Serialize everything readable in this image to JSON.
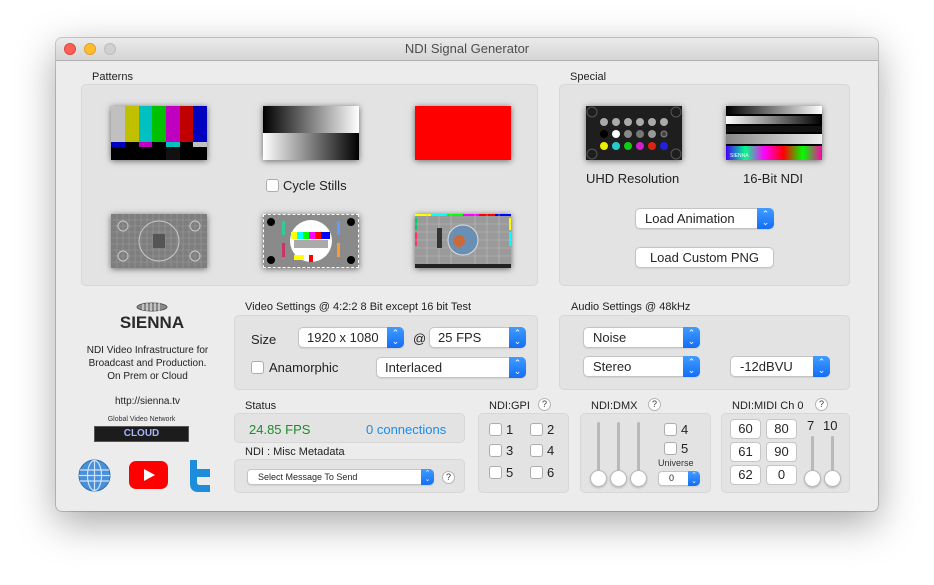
{
  "window": {
    "title": "NDI Signal Generator",
    "traffic_lights": [
      "close",
      "minimize",
      "zoom"
    ]
  },
  "patterns": {
    "label": "Patterns",
    "items": [
      {
        "name": "SMPTE Color Bars"
      },
      {
        "name": "Grayscale Ramp"
      },
      {
        "name": "Red Field"
      },
      {
        "name": "Grid Test Card"
      },
      {
        "name": "PM5544-style Test Card"
      },
      {
        "name": "Test Card F"
      }
    ],
    "cycle_stills_label": "Cycle Stills",
    "cycle_stills_checked": false
  },
  "special": {
    "label": "Special",
    "items": [
      {
        "label": "UHD Resolution"
      },
      {
        "label": "16-Bit NDI"
      }
    ],
    "load_animation": "Load Animation",
    "load_custom_png": "Load Custom PNG"
  },
  "brand": {
    "logo_text": "SIENNA",
    "tagline_1": "NDI Video Infrastructure for",
    "tagline_2": "Broadcast and Production.",
    "tagline_3": "On Prem or Cloud",
    "url": "http://sienna.tv",
    "network_label": "Global Video Network",
    "cloud_badge": "CLOUD",
    "social_icons": [
      "globe-icon",
      "youtube-icon",
      "twitter-icon"
    ]
  },
  "video": {
    "label": "Video Settings @ 4:2:2 8 Bit except 16 bit Test",
    "size_label": "Size",
    "size_value": "1920 x 1080",
    "at_label": "@",
    "fps_value": "25 FPS",
    "anamorphic_label": "Anamorphic",
    "anamorphic_checked": false,
    "scan_value": "Interlaced"
  },
  "audio": {
    "label": "Audio Settings @ 48kHz",
    "signal_value": "Noise",
    "channels_value": "Stereo",
    "level_value": "-12dBVU"
  },
  "status": {
    "label": "Status",
    "fps": "24.85 FPS",
    "connections": "0 connections",
    "fps_color": "#1f8a2e",
    "connections_color": "#1a8cf0"
  },
  "metadata": {
    "label": "NDI : Misc Metadata",
    "select_value": "Select Message To Send",
    "help": "?"
  },
  "gpi": {
    "label": "NDI:GPI",
    "help": "?",
    "items": [
      {
        "label": "1",
        "checked": false
      },
      {
        "label": "2",
        "checked": false
      },
      {
        "label": "3",
        "checked": false
      },
      {
        "label": "4",
        "checked": false
      },
      {
        "label": "5",
        "checked": false
      },
      {
        "label": "6",
        "checked": false
      }
    ]
  },
  "dmx": {
    "label": "NDI:DMX",
    "help": "?",
    "sliders": [
      0,
      0,
      0
    ],
    "checks": [
      {
        "label": "4",
        "checked": false
      },
      {
        "label": "5",
        "checked": false
      }
    ],
    "universe_label": "Universe",
    "universe_value": "0"
  },
  "midi": {
    "label": "NDI:MIDI Ch 0",
    "help": "?",
    "values": [
      "60",
      "80",
      "61",
      "90",
      "62",
      "0"
    ],
    "slider_labels": [
      "7",
      "10"
    ],
    "sliders": [
      0,
      0
    ]
  }
}
